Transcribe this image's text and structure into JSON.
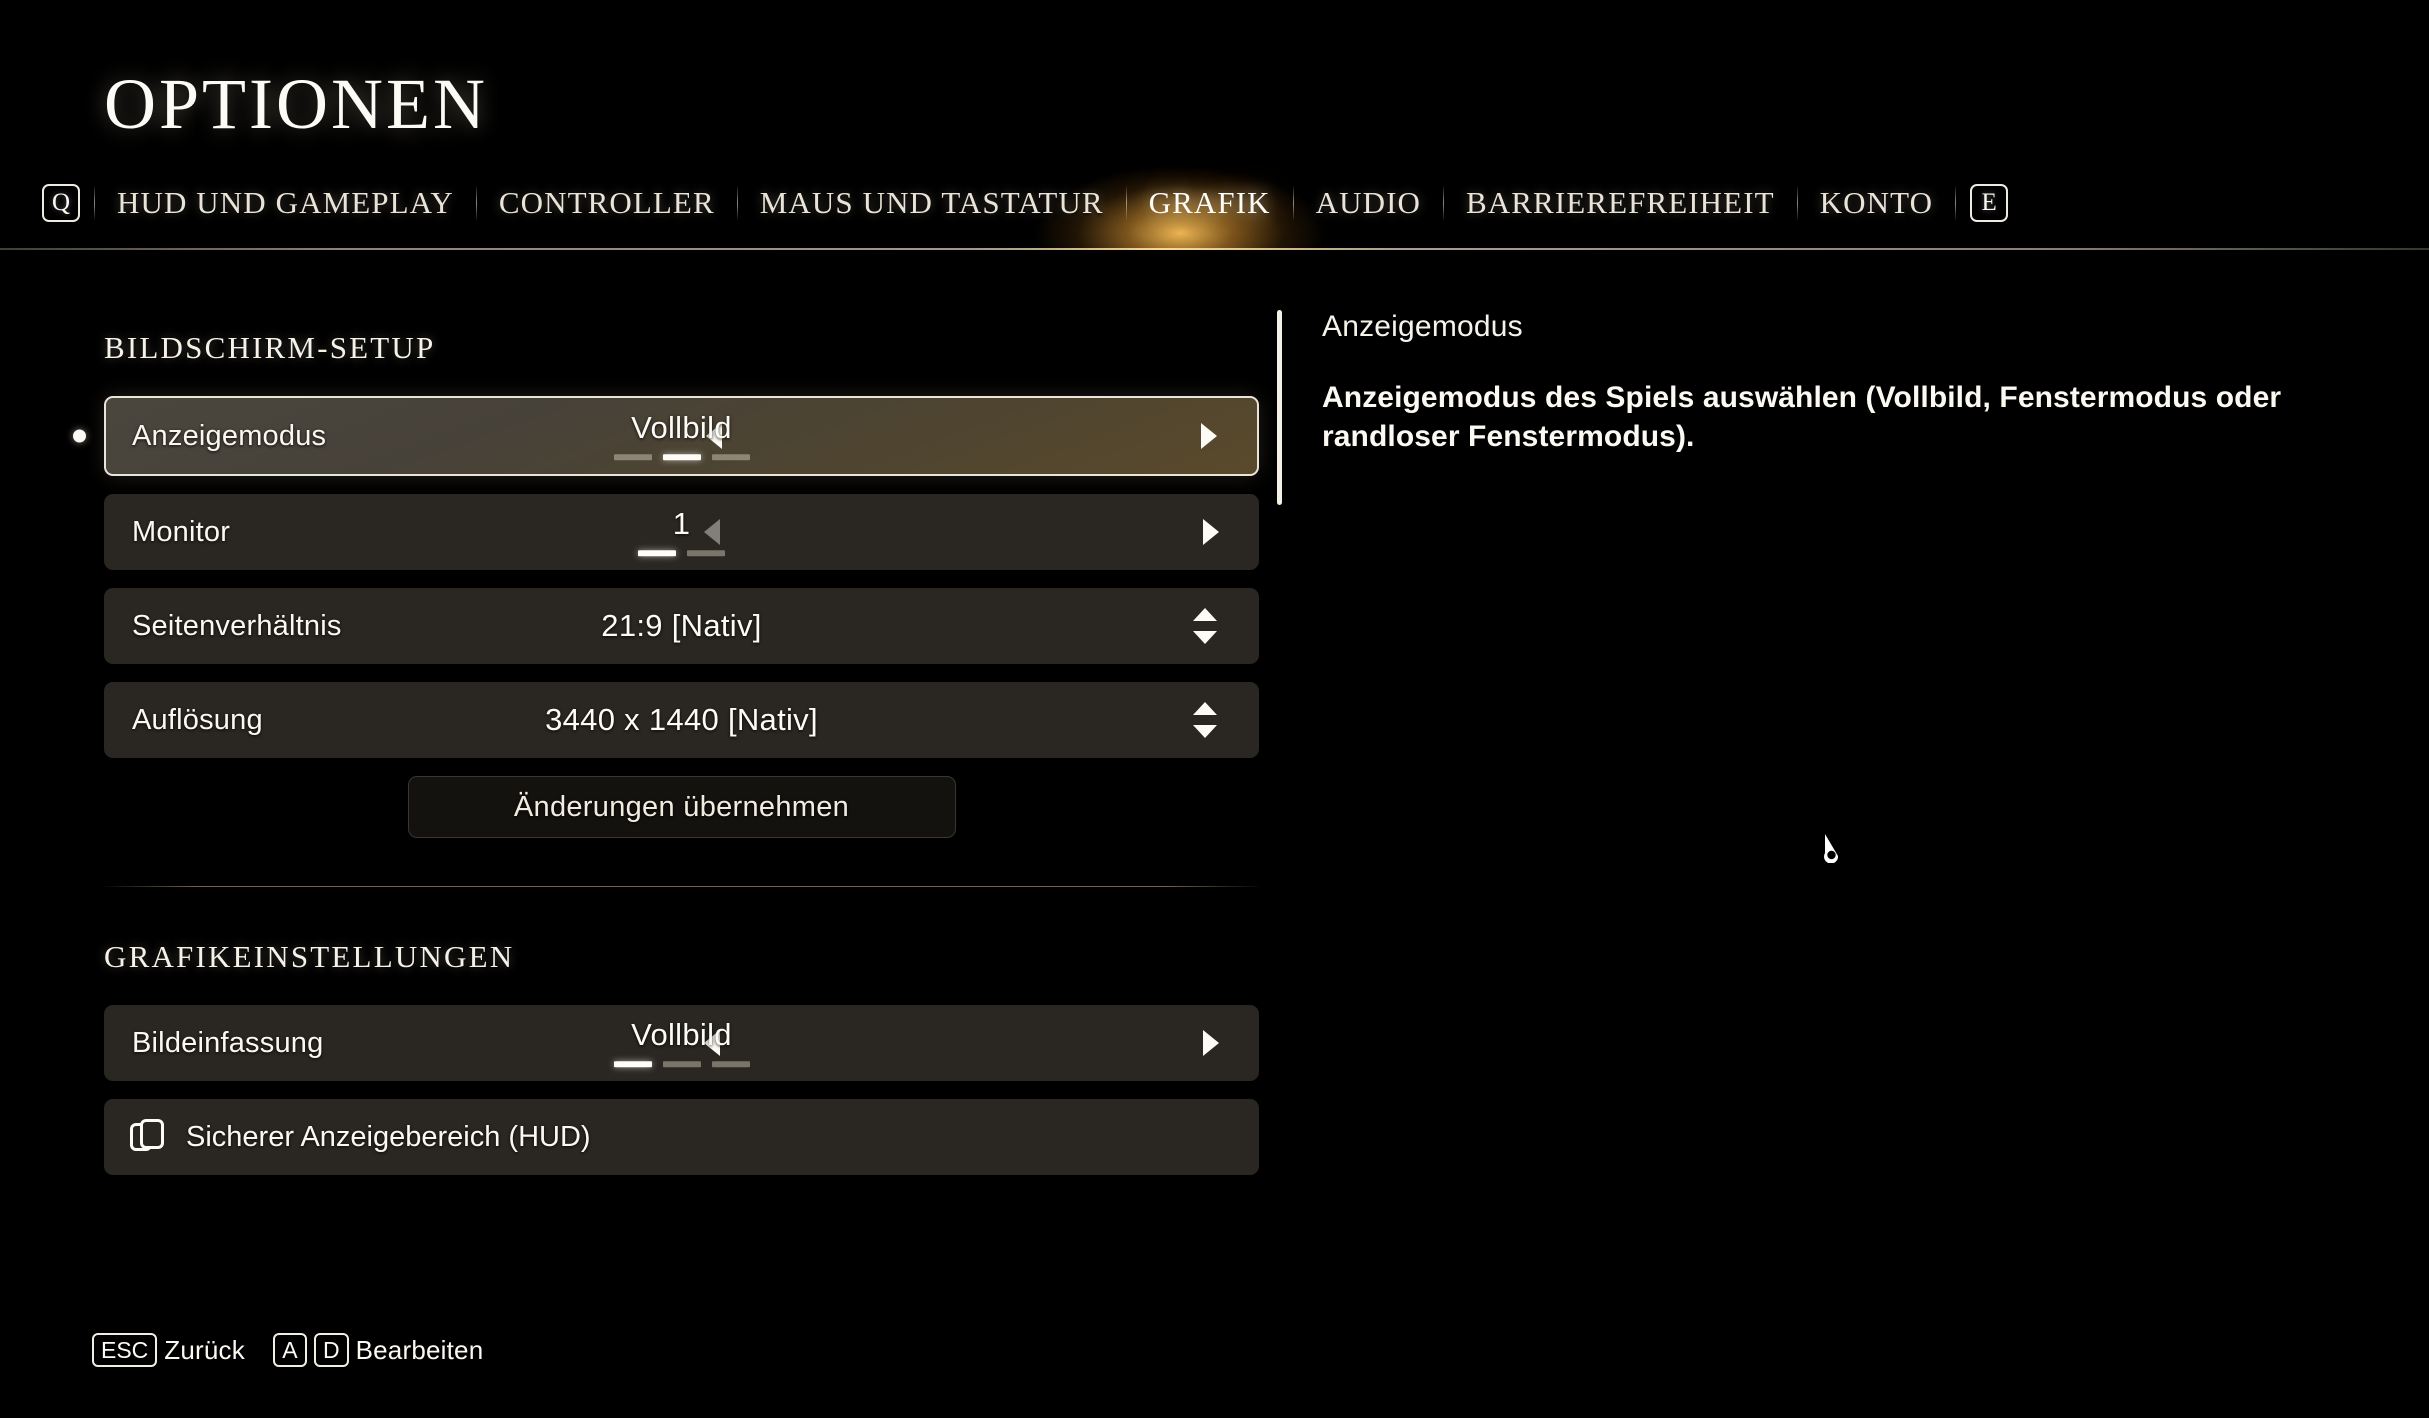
{
  "header": {
    "title": "OPTIONEN",
    "left_key": "Q",
    "right_key": "E",
    "tabs": [
      {
        "label": "HUD UND GAMEPLAY",
        "active": false
      },
      {
        "label": "CONTROLLER",
        "active": false
      },
      {
        "label": "MAUS UND TASTATUR",
        "active": false
      },
      {
        "label": "GRAFIK",
        "active": true
      },
      {
        "label": "AUDIO",
        "active": false
      },
      {
        "label": "BARRIEREFREIHEIT",
        "active": false
      },
      {
        "label": "KONTO",
        "active": false
      }
    ]
  },
  "sections": {
    "display_setup": {
      "heading": "BILDSCHIRM-SETUP",
      "rows": [
        {
          "label": "Anzeigemodus",
          "value": "Vollbild",
          "type": "stepper-dashes",
          "dash_count": 3,
          "dash_active": 2,
          "selected": true,
          "left_arrow_dim": false,
          "right_arrow_dim": false
        },
        {
          "label": "Monitor",
          "value": "1",
          "type": "stepper-dashes",
          "dash_count": 2,
          "dash_active": 1,
          "selected": false,
          "left_arrow_dim": true,
          "right_arrow_dim": false
        },
        {
          "label": "Seitenverhältnis",
          "value": "21:9 [Nativ]",
          "type": "select",
          "selected": false
        },
        {
          "label": "Auflösung",
          "value": "3440 x 1440 [Nativ]",
          "type": "select",
          "selected": false
        }
      ],
      "apply_button": "Änderungen übernehmen"
    },
    "graphics_settings": {
      "heading": "GRAFIKEINSTELLUNGEN",
      "rows": [
        {
          "label": "Bildeinfassung",
          "value": "Vollbild",
          "type": "stepper-dashes",
          "dash_count": 3,
          "dash_active": 1,
          "selected": false,
          "left_arrow_dim": false,
          "right_arrow_dim": false
        }
      ],
      "hud_row": {
        "label": "Sicherer Anzeigebereich (HUD)",
        "icon": "overlapping-frames-icon"
      }
    }
  },
  "description": {
    "title": "Anzeigemodus",
    "body": "Anzeigemodus des Spiels auswählen (Vollbild, Fenstermodus oder randloser Fenstermodus)."
  },
  "footer": {
    "hints": [
      {
        "keys": [
          "ESC"
        ],
        "label": "Zurück"
      },
      {
        "keys": [
          "A",
          "D"
        ],
        "label": "Bearbeiten"
      }
    ]
  },
  "colors": {
    "background": "#000000",
    "row_fill": "#2a2722",
    "row_selected_border": "#e9e4d8",
    "accent_glow": "#ffc65c",
    "text": "#fdfbf5"
  }
}
